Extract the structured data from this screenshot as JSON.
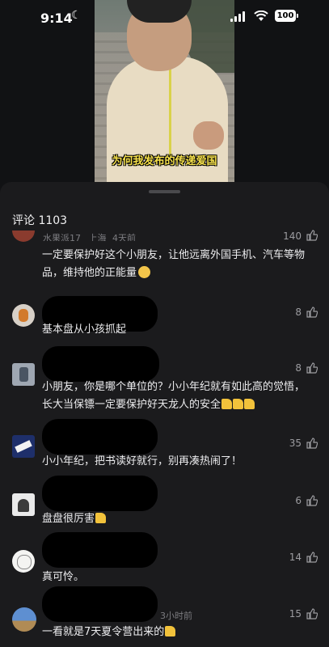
{
  "status": {
    "time": "9:14",
    "battery": "100"
  },
  "video": {
    "caption": "为何我发布的传递爱国"
  },
  "comments_header": {
    "count_label": "评论 1103"
  },
  "comments": [
    {
      "user": "水果派17",
      "location": "上海",
      "time": "4天前",
      "likes": "140",
      "text": "一定要保护好这个小朋友，让他远离外国手机、汽车等物品，维持他的正能量"
    },
    {
      "likes": "8",
      "text": "基本盘从小孩抓起"
    },
    {
      "likes": "8",
      "text": "小朋友，你是哪个单位的？小小年纪就有如此高的觉悟，长大当保镖一定要保护好天龙人的安全"
    },
    {
      "likes": "35",
      "text": "小小年纪，把书读好就行，别再凑热闹了！"
    },
    {
      "likes": "6",
      "text": "盘盘很厉害"
    },
    {
      "likes": "14",
      "text": "真可怜。"
    },
    {
      "time": "3小时前",
      "likes": "15",
      "text": "一看就是7天夏令营出来的"
    }
  ],
  "colors": {
    "background": "#111214",
    "sheet": "#1b1b1d",
    "thumb_emoji": "#f2c23b"
  }
}
